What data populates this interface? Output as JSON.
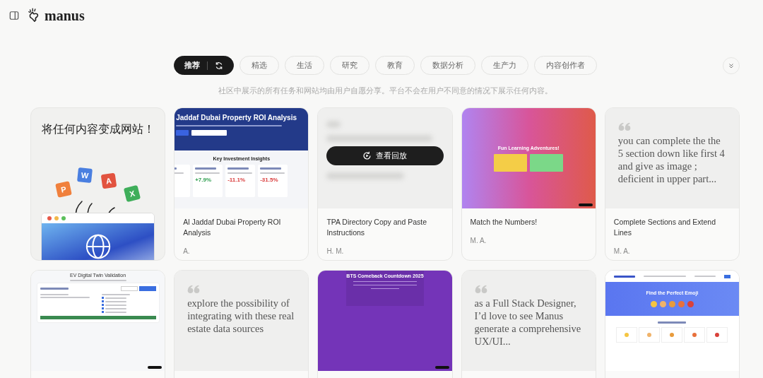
{
  "header": {
    "brand": "manus"
  },
  "tabs": [
    {
      "label": "推荐",
      "selected": true
    },
    {
      "label": "精选",
      "selected": false
    },
    {
      "label": "生活",
      "selected": false
    },
    {
      "label": "研究",
      "selected": false
    },
    {
      "label": "教育",
      "selected": false
    },
    {
      "label": "数据分析",
      "selected": false
    },
    {
      "label": "生产力",
      "selected": false
    },
    {
      "label": "内容创作者",
      "selected": false
    }
  ],
  "notice": "社区中展示的所有任务和网站均由用户自愿分享。平台不会在用户不同意的情况下展示任何内容。",
  "cards": [
    {
      "kind": "hero",
      "headline": "将任何内容变成网站！",
      "tiles": [
        {
          "letter": "P",
          "color": "#f0803c"
        },
        {
          "letter": "W",
          "color": "#4a7fe0"
        },
        {
          "letter": "A",
          "color": "#e2533f"
        },
        {
          "letter": "X",
          "color": "#3fae5a"
        }
      ]
    },
    {
      "kind": "preview",
      "preview": {
        "kind": "roi",
        "title": "Jaddaf Dubai Property ROI Analysis",
        "section": "Key Investment Insights",
        "items": [
          {
            "value": "+7.9%",
            "color": "#2e9e4f"
          },
          {
            "value": "-11.1%",
            "color": "#d93a3a"
          },
          {
            "value": "-31.5%",
            "color": "#d93a3a"
          }
        ]
      },
      "title": "Al Jaddaf Dubai Property ROI Analysis",
      "author": "A."
    },
    {
      "kind": "replay",
      "button": "查看回放",
      "title": "TPA Directory Copy and Paste Instructions",
      "author": "H. M."
    },
    {
      "kind": "preview",
      "preview": {
        "kind": "learning",
        "title": "Fun Learning Adventures!",
        "buttons": [
          {
            "color": "#f4cd47"
          },
          {
            "color": "#7bd888"
          }
        ]
      },
      "title": "Match the Numbers!",
      "author": "M. A."
    },
    {
      "kind": "quote",
      "quote": "you can complete the the 5 section down like first 4 and give as image ; deficient in upper part...",
      "title": "Complete Sections and Extend Lines",
      "author": "M. A."
    },
    {
      "kind": "preview",
      "preview": {
        "kind": "ev",
        "title": "EV Digital Twin Validation"
      }
    },
    {
      "kind": "quote",
      "quote": "explore the possibility of integrating with these real estate data sources"
    },
    {
      "kind": "preview",
      "preview": {
        "kind": "bts",
        "title": "BTS Comeback Countdown 2025"
      }
    },
    {
      "kind": "quote",
      "quote": "as a Full Stack Designer, I’d love to see Manus generate a comprehensive UX/UI..."
    },
    {
      "kind": "preview",
      "preview": {
        "kind": "emoji",
        "title": "Find the Perfect Emoji",
        "categories": [
          {
            "color": "#f5c542"
          },
          {
            "color": "#f0b36a"
          },
          {
            "color": "#e89b3c"
          },
          {
            "color": "#e8703c"
          },
          {
            "color": "#d9413a"
          }
        ]
      }
    }
  ]
}
